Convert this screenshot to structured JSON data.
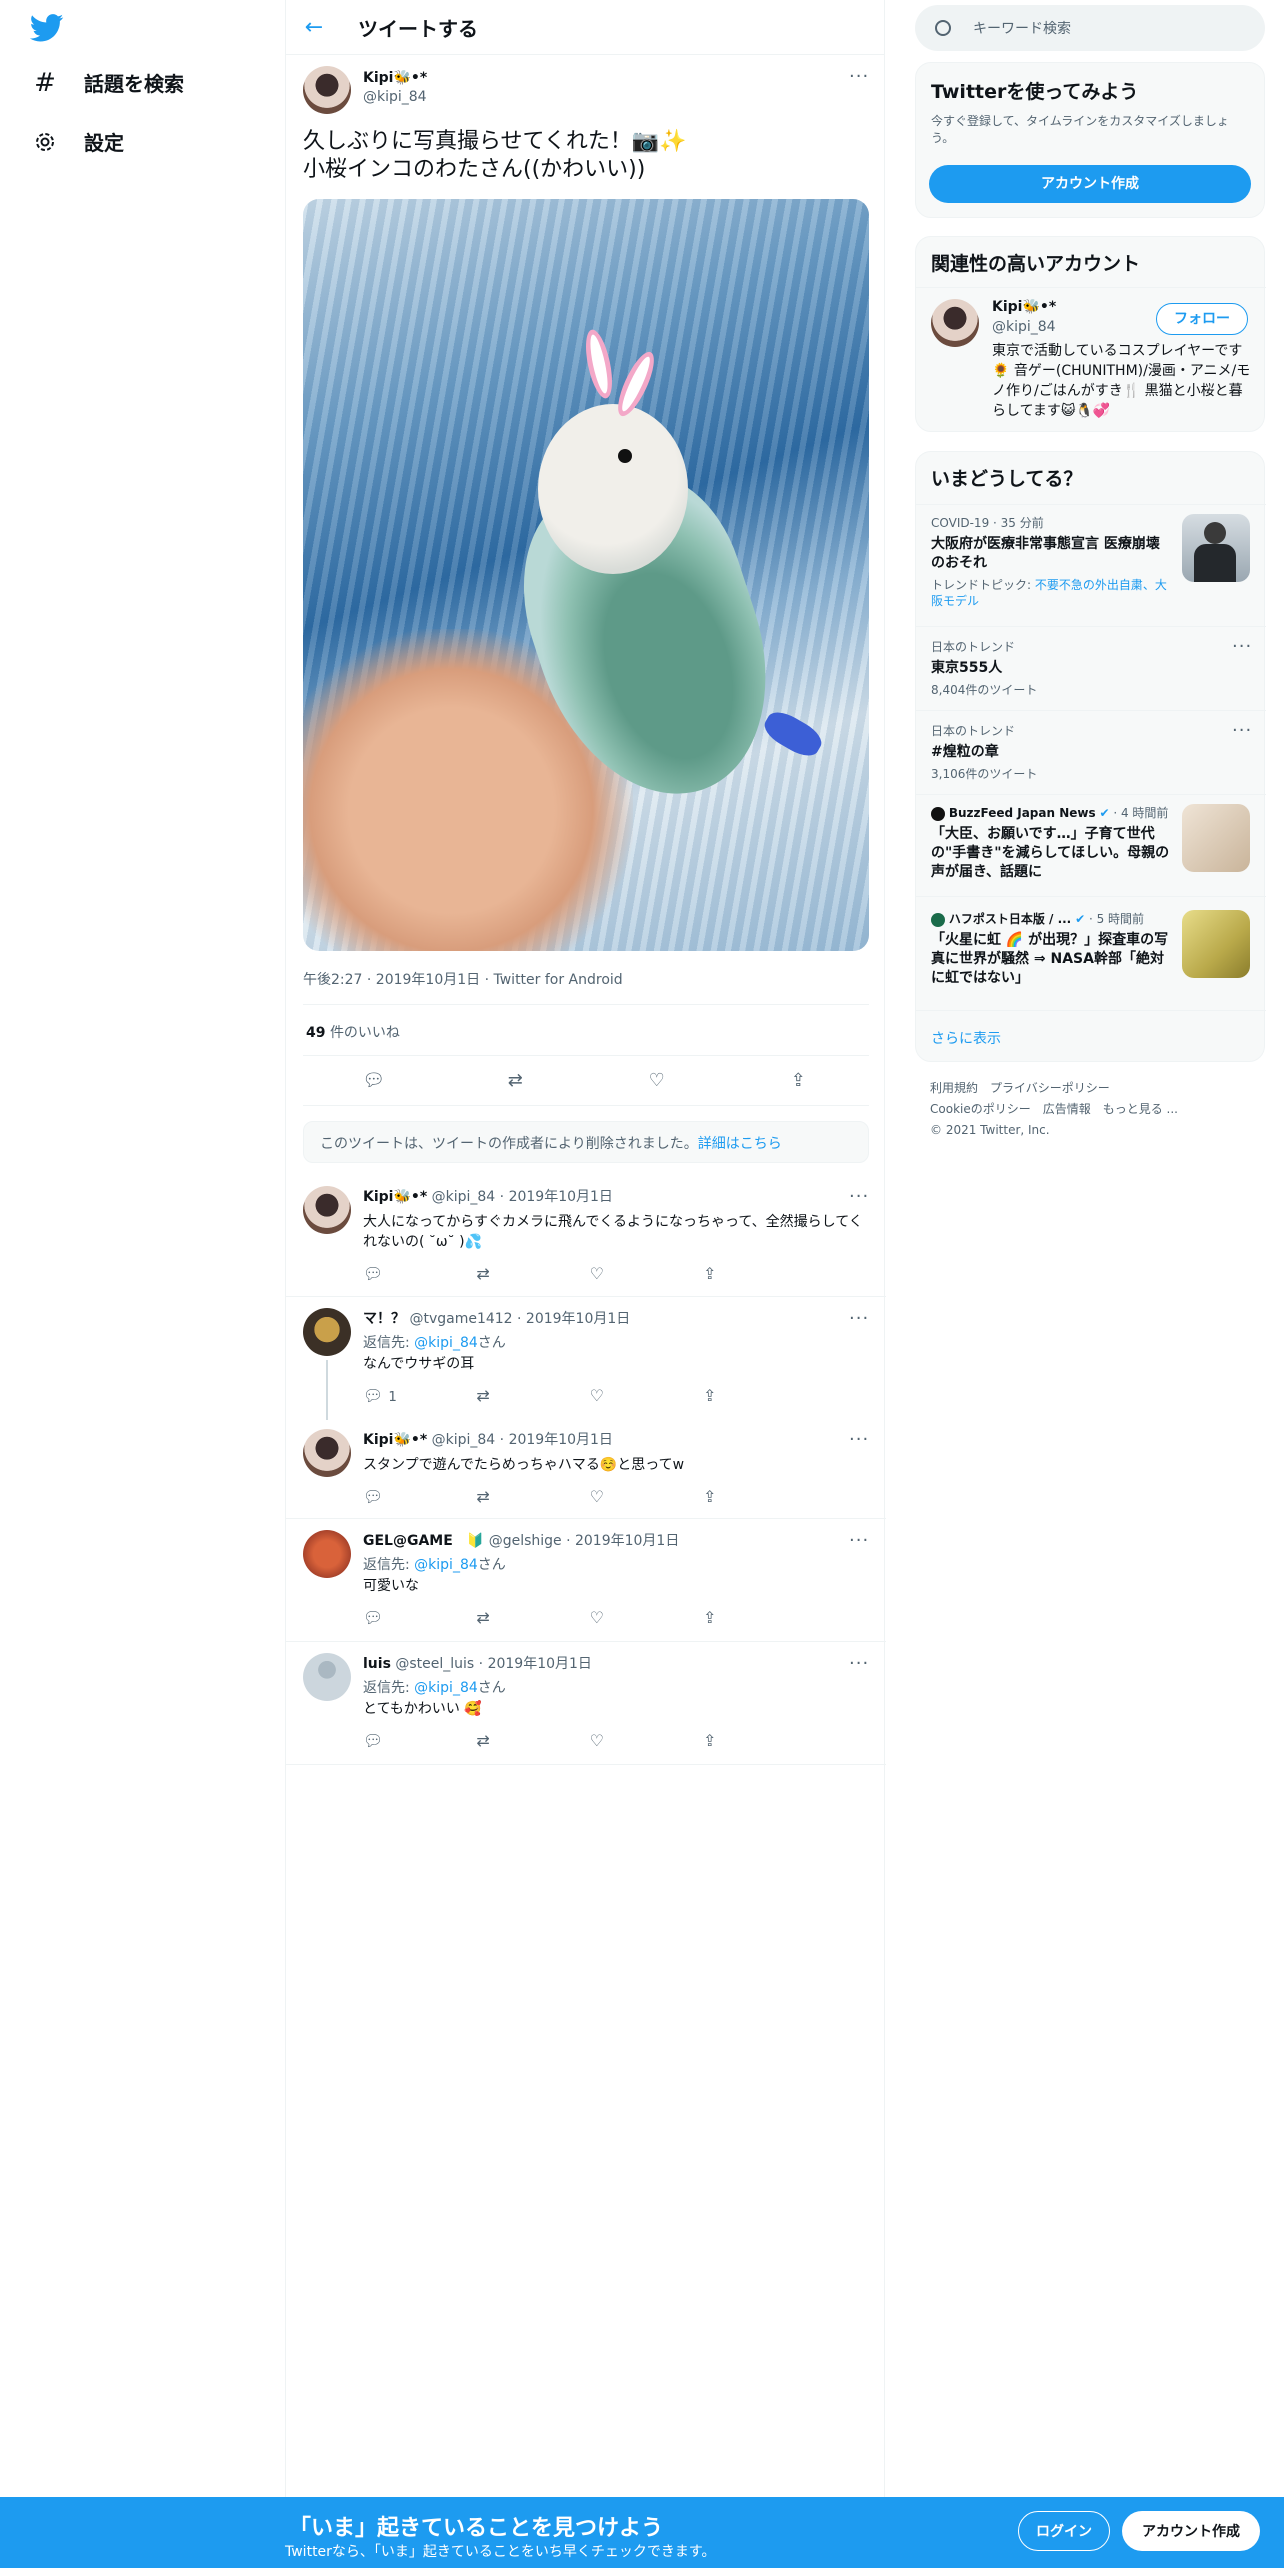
{
  "nav": {
    "logo_icon": "twitter-bird-icon",
    "explore_label": "話題を検索",
    "settings_label": "設定"
  },
  "header": {
    "title": "ツイートする"
  },
  "tweet": {
    "display_name": "Kipi🐝•*",
    "handle": "@kipi_84",
    "text": "久しぶりに写真撮らせてくれた！📷✨\n小桜インコのわたさん((かわいい))",
    "meta": "午後2:27 · 2019年10月1日 · Twitter for Android",
    "like_count": "49",
    "like_label": "件のいいね",
    "notice": "このツイートは、ツイートの作成者により削除されました。",
    "notice_link": "詳細はこちら"
  },
  "replies": [
    {
      "name": "Kipi🐝•*",
      "handle": "@kipi_84",
      "date": "· 2019年10月1日",
      "reply_to": "",
      "reply_to_handle": "",
      "reply_to_suffix": "",
      "text": "大人になってからすぐカメラに飛んでくるようになっちゃって、全然撮らしてくれないの( ˘ω˘ )💦",
      "reply_count": ""
    },
    {
      "name": "マ！？",
      "handle": "@tvgame1412",
      "date": "· 2019年10月1日",
      "reply_to": "返信先: ",
      "reply_to_handle": "@kipi_84",
      "reply_to_suffix": "さん",
      "text": "なんでウサギの耳",
      "reply_count": "1"
    },
    {
      "name": "Kipi🐝•*",
      "handle": "@kipi_84",
      "date": "· 2019年10月1日",
      "reply_to": "",
      "reply_to_handle": "",
      "reply_to_suffix": "",
      "text": "スタンプで遊んでたらめっちゃハマる☺️と思ってw",
      "reply_count": ""
    },
    {
      "name": "GEL@GAME　🔰",
      "handle": "@gelshige",
      "date": "· 2019年10月1日",
      "reply_to": "返信先: ",
      "reply_to_handle": "@kipi_84",
      "reply_to_suffix": "さん",
      "text": "可愛いな",
      "reply_count": ""
    },
    {
      "name": "luis",
      "handle": "@steel_luis",
      "date": "· 2019年10月1日",
      "reply_to": "返信先: ",
      "reply_to_handle": "@kipi_84",
      "reply_to_suffix": "さん",
      "text": "とてもかわいい 🥰",
      "reply_count": ""
    }
  ],
  "search": {
    "placeholder": "キーワード検索"
  },
  "signup_card": {
    "title": "Twitterを使ってみよう",
    "desc": "今すぐ登録して、タイムラインをカスタマイズしましょう。",
    "button": "アカウント作成"
  },
  "related": {
    "title": "関連性の高いアカウント",
    "name": "Kipi🐝•*",
    "handle": "@kipi_84",
    "follow": "フォロー",
    "bio": "東京で活動しているコスプレイヤーです🌻 音ゲー(CHUNITHM)/漫画・アニメ/モノ作り/ごはんがすき🍴 黒猫と小桜と暮らしてます😺🐧💞"
  },
  "trends": {
    "title": "いまどうしてる？",
    "items": [
      {
        "meta": "COVID-19 · 35 分前",
        "title": "大阪府が医療非常事態宣言 医療崩壊のおそれ",
        "sub_prefix": "トレンドトピック: ",
        "sub_links": "不要不急の外出自粛、大阪モデル"
      },
      {
        "meta": "日本のトレンド",
        "title": "東京555人",
        "count": "8,404件のツイート"
      },
      {
        "meta": "日本のトレンド",
        "title": "#煌粒の章",
        "count": "3,106件のツイート"
      },
      {
        "source": "BuzzFeed Japan News",
        "time": "· 4 時間前",
        "title": "「大臣、お願いです…」子育て世代の\"手書き\"を減らしてほしい。母親の声が届き、話題に"
      },
      {
        "source": "ハフポスト日本版 / ...",
        "time": "· 5 時間前",
        "title": "「火星に虹 🌈 が出現？」探査車の写真に世界が騒然 ⇒ NASA幹部「絶対に虹ではない」"
      }
    ],
    "show_more": "さらに表示"
  },
  "footer": {
    "line1": "利用規約　プライバシーポリシー",
    "line2": "Cookieのポリシー　広告情報　もっと見る ...",
    "line3": "© 2021 Twitter, Inc."
  },
  "bottom": {
    "title": "「いま」起きていることを見つけよう",
    "sub": "Twitterなら、「いま」起きていることをいち早くチェックできます。",
    "login": "ログイン",
    "signup": "アカウント作成"
  },
  "colors": {
    "accent": "#1d9bf0",
    "text": "#0f1419",
    "muted": "#536471"
  }
}
